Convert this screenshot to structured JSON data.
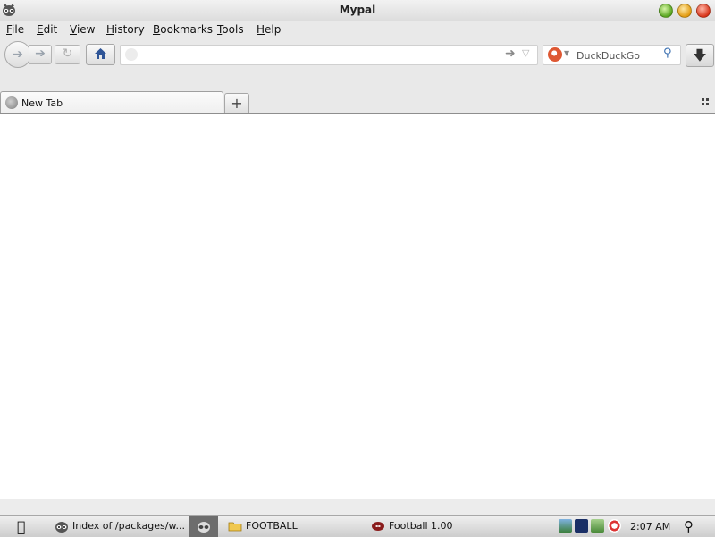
{
  "window": {
    "title": "Mypal"
  },
  "menu": {
    "items": [
      "File",
      "Edit",
      "View",
      "History",
      "Bookmarks",
      "Tools",
      "Help"
    ]
  },
  "navbar": {
    "url_value": "",
    "search_engine": "DuckDuckGo",
    "search_placeholder": "DuckDuckGo"
  },
  "tabs": [
    {
      "label": "New Tab",
      "active": true
    }
  ],
  "taskbar": {
    "tasks": [
      {
        "label": "Index of /packages/w...",
        "icon": "mypal-icon"
      },
      {
        "label": "",
        "icon": "mypal-icon",
        "active": true
      },
      {
        "label": "FOOTBALL",
        "icon": "folder-icon"
      },
      {
        "label": "Football 1.00",
        "icon": "football-icon"
      }
    ],
    "clock": "2:07 AM"
  },
  "colors": {
    "chrome_bg": "#e9e9e9",
    "home_icon": "#2f5597",
    "search_icon": "#3a6fb0",
    "ddg_brand": "#de5833"
  }
}
